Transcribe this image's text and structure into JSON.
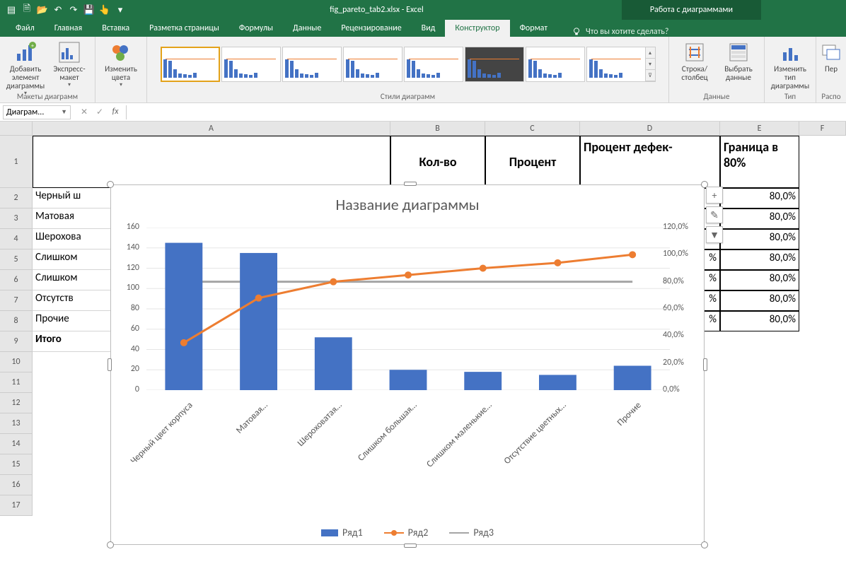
{
  "title": {
    "file": "fig_pareto_tab2.xlsx  -  Excel",
    "tooltab": "Работа с диаграммами"
  },
  "tabs": {
    "list": [
      "Файл",
      "Главная",
      "Вставка",
      "Разметка страницы",
      "Формулы",
      "Данные",
      "Рецензирование",
      "Вид",
      "Конструктор",
      "Формат"
    ],
    "active": "Конструктор",
    "tellme": "Что вы хотите сделать?"
  },
  "ribbon": {
    "g1": {
      "btn1": "Добавить элемент диаграммы",
      "btn2": "Экспресс-макет",
      "label": "Макеты диаграмм"
    },
    "g2": {
      "btn": "Изменить цвета"
    },
    "g3": {
      "label": "Стили диаграмм"
    },
    "g4": {
      "btn1": "Строка/столбец",
      "btn2": "Выбрать данные",
      "label": "Данные"
    },
    "g5": {
      "btn": "Изменить тип диаграммы",
      "label": "Тип"
    },
    "g6": {
      "btn": "Пер",
      "label": "Распо"
    }
  },
  "fbar": {
    "namebox": "Диаграм..."
  },
  "cols": {
    "A": "A",
    "B": "B",
    "C": "C",
    "D": "D",
    "E": "E",
    "F": "F"
  },
  "rows": [
    "1",
    "2",
    "3",
    "4",
    "5",
    "6",
    "7",
    "8",
    "9",
    "10",
    "11",
    "12",
    "13",
    "14",
    "15",
    "16",
    "17"
  ],
  "headers": {
    "B": "Кол-во",
    "C": "Процент",
    "D": "Процент дефек-",
    "E": "Граница в 80%"
  },
  "cellsA": {
    "2": "Черный ш",
    "3": "Матовая",
    "4": "Шерохова",
    "5": "Слишком",
    "6": "Слишком",
    "7": "Отсутств",
    "8": "Прочие",
    "9": "Итого"
  },
  "cellsE": {
    "2": "80,0%",
    "3": "80,0%",
    "4": "80,0%",
    "5": "80,0%",
    "6": "80,0%",
    "7": "80,0%",
    "8": "80,0%"
  },
  "cellsDpct": {
    "2": "%",
    "3": "%",
    "4": "%",
    "5": "%",
    "6": "%",
    "7": "%",
    "8": "%"
  },
  "chart_data": {
    "type": "pareto",
    "title": "Название диаграммы",
    "categories": [
      "Черный цвет корпуса",
      "Матовая…",
      "Шероховатая…",
      "Слишком большая…",
      "Слишком маленькие…",
      "Отсутствие цветных…",
      "Прочие"
    ],
    "series": [
      {
        "name": "Ряд1",
        "type": "bar",
        "values": [
          145,
          135,
          52,
          20,
          18,
          15,
          24
        ]
      },
      {
        "name": "Ряд2",
        "type": "line",
        "values": [
          35,
          68,
          80,
          85,
          90,
          94,
          100
        ]
      },
      {
        "name": "Ряд3",
        "type": "line",
        "values": [
          80,
          80,
          80,
          80,
          80,
          80,
          80
        ]
      }
    ],
    "y1": {
      "min": 0,
      "max": 160,
      "step": 20,
      "ticks": [
        "0",
        "20",
        "40",
        "60",
        "80",
        "100",
        "120",
        "140",
        "160"
      ]
    },
    "y2": {
      "min": 0,
      "max": 120,
      "step": 20,
      "ticks": [
        "0,0%",
        "20,0%",
        "40,0%",
        "60,0%",
        "80,0%",
        "100,0%",
        "120,0%"
      ]
    },
    "colors": {
      "bar": "#4472C4",
      "line1": "#ED7D31",
      "line2": "#A5A5A5"
    }
  },
  "sidetools": {
    "add": "+",
    "brush": "✎",
    "filter": "▼"
  }
}
